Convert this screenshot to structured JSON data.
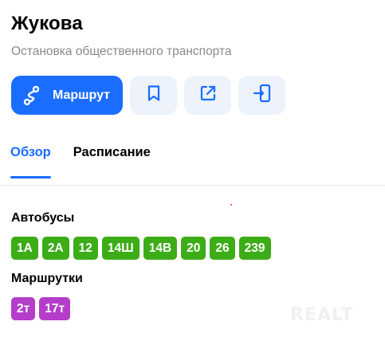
{
  "header": {
    "title": "Жукова",
    "subtitle": "Остановка общественного транспорта"
  },
  "actions": {
    "route_label": "Маршрут",
    "route_icon": "route-icon",
    "bookmark_icon": "bookmark-icon",
    "share_icon": "share-icon",
    "send_to_phone_icon": "send-to-phone-icon"
  },
  "tabs": [
    {
      "label": "Обзор",
      "active": true
    },
    {
      "label": "Расписание",
      "active": false
    }
  ],
  "buses": {
    "label": "Автобусы",
    "color": "#3cac17",
    "routes": [
      "1А",
      "2А",
      "12",
      "14Ш",
      "14В",
      "20",
      "26",
      "239"
    ]
  },
  "minibuses": {
    "label": "Маршрутки",
    "color": "#b43ec9",
    "routes": [
      "2т",
      "17т"
    ]
  },
  "watermark": "REALT",
  "colors": {
    "accent": "#1a6dff",
    "secondary_button_bg": "#edf2fb"
  }
}
